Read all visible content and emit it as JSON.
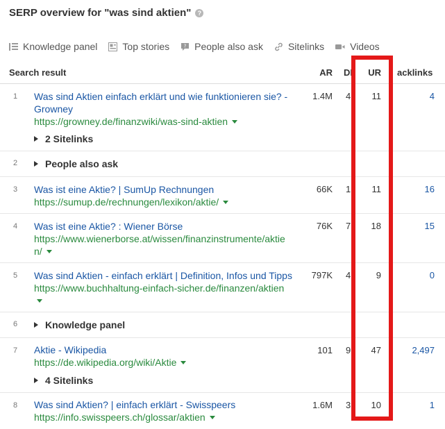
{
  "page": {
    "title": "SERP overview for \"was sind aktien\"",
    "help_icon": "?"
  },
  "features": [
    {
      "label": "Knowledge panel",
      "icon": "list-icon"
    },
    {
      "label": "Top stories",
      "icon": "newspaper-icon"
    },
    {
      "label": "People also ask",
      "icon": "question-bubble-icon"
    },
    {
      "label": "Sitelinks",
      "icon": "link-icon"
    },
    {
      "label": "Videos",
      "icon": "video-camera-icon"
    }
  ],
  "table": {
    "headers": {
      "search_result": "Search result",
      "ar": "AR",
      "dr": "DR",
      "ur": "UR",
      "backlinks": "acklinks"
    },
    "rows": [
      {
        "num": "1",
        "title": "Was sind Aktien einfach erklärt und wie funktionieren sie? - Growney",
        "url": "https://growney.de/finanzwiki/was-sind-aktien",
        "expand": "2 Sitelinks",
        "ar": "1.4M",
        "dr": "4",
        "ur": "11",
        "backlinks": "4"
      },
      {
        "num": "2",
        "expand": "People also ask"
      },
      {
        "num": "3",
        "title": "Was ist eine Aktie? | SumUp Rechnungen",
        "url": "https://sumup.de/rechnungen/lexikon/aktie/",
        "ar": "66K",
        "dr": "1",
        "ur": "11",
        "backlinks": "16"
      },
      {
        "num": "4",
        "title": "Was ist eine Aktie? : Wiener Börse",
        "url": "https://www.wienerborse.at/wissen/finanzinstrumente/aktien/",
        "ar": "76K",
        "dr": "7",
        "ur": "18",
        "backlinks": "15"
      },
      {
        "num": "5",
        "title": "Was sind Aktien - einfach erklärt | Definition, Infos und Tipps",
        "url": "https://www.buchhaltung-einfach-sicher.de/finanzen/aktien",
        "ar": "797K",
        "dr": "4",
        "ur": "9",
        "backlinks": "0"
      },
      {
        "num": "6",
        "expand": "Knowledge panel"
      },
      {
        "num": "7",
        "title": "Aktie - Wikipedia",
        "url": "https://de.wikipedia.org/wiki/Aktie",
        "expand": "4 Sitelinks",
        "ar": "101",
        "dr": "9",
        "ur": "47",
        "backlinks": "2,497"
      },
      {
        "num": "8",
        "title": "Was sind Aktien? | einfach erklärt - Swisspeers",
        "url": "https://info.swisspeers.ch/glossar/aktien",
        "ar": "1.6M",
        "dr": "3",
        "ur": "10",
        "backlinks": "1"
      }
    ]
  },
  "colors": {
    "link": "#1a56a4",
    "url": "#2a8a3e",
    "highlight_box": "#e41919"
  }
}
